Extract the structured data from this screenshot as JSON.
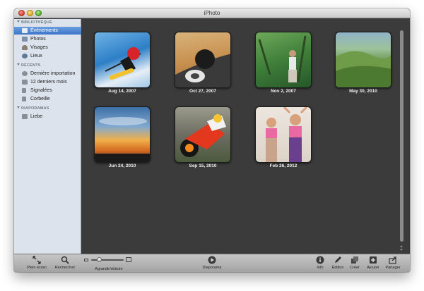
{
  "window": {
    "title": "iPhoto"
  },
  "sidebar": {
    "sections": [
      {
        "label": "BIBLIOTHÈQUE",
        "items": [
          {
            "label": "Évènements",
            "icon": "events-icon",
            "selected": true
          },
          {
            "label": "Photos",
            "icon": "photos-icon"
          },
          {
            "label": "Visages",
            "icon": "faces-icon"
          },
          {
            "label": "Lieux",
            "icon": "places-icon"
          }
        ]
      },
      {
        "label": "RÉCENTS",
        "items": [
          {
            "label": "Dernière importation",
            "icon": "last-import-icon"
          },
          {
            "label": "12 derniers mois",
            "icon": "calendar-icon"
          },
          {
            "label": "Signalées",
            "icon": "flag-icon"
          },
          {
            "label": "Corbeille",
            "icon": "trash-icon"
          }
        ]
      },
      {
        "label": "DIAPORAMAS",
        "items": [
          {
            "label": "Liebe",
            "icon": "slideshow-icon"
          }
        ]
      }
    ]
  },
  "events": [
    {
      "date": "Aug 14, 2007",
      "thumb": "kitesurfer"
    },
    {
      "date": "Oct 27, 2007",
      "thumb": "motorcycle-helmet"
    },
    {
      "date": "Nov 2, 2007",
      "thumb": "person-in-forest"
    },
    {
      "date": "May 30, 2010",
      "thumb": "green-hills"
    },
    {
      "date": "Jun 24, 2010",
      "thumb": "sunset-sky"
    },
    {
      "date": "Sep 15, 2010",
      "thumb": "racing-motorcycle"
    },
    {
      "date": "Feb 26, 2012",
      "thumb": "fitness-women"
    }
  ],
  "toolbar": {
    "fullscreen": "Plein écran",
    "search": "Rechercher",
    "zoom": "Agrandir/réduire",
    "slideshow": "Diaporama",
    "info": "Info",
    "edit": "Édition",
    "create": "Créer",
    "add": "Ajouter",
    "share": "Partager"
  },
  "colors": {
    "selection": "#3d75c9",
    "sidebar": "#dce3ec",
    "main_bg": "#3b3b3b"
  }
}
